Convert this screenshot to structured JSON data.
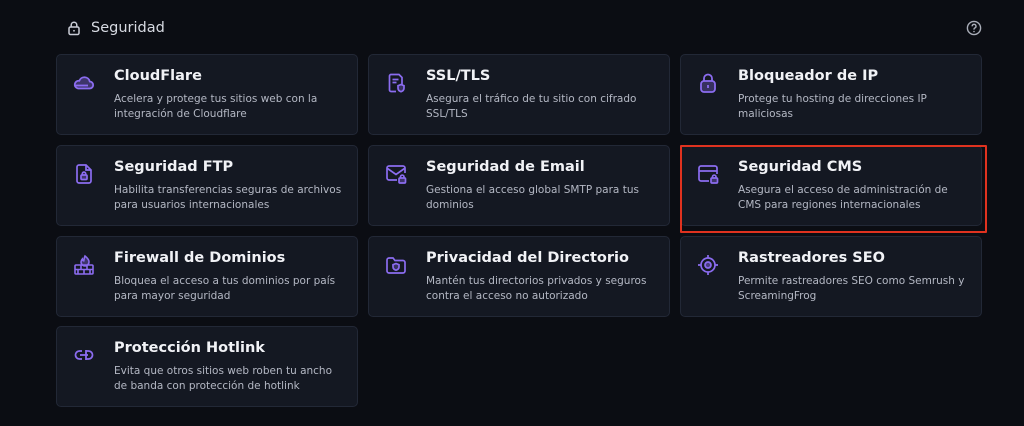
{
  "section": {
    "title": "Seguridad",
    "icon": "lock-icon",
    "help_icon": "help-circle-icon"
  },
  "cards": [
    {
      "title": "CloudFlare",
      "desc": "Acelera y protege tus sitios web con la integración de Cloudflare",
      "icon": "cloud-icon"
    },
    {
      "title": "SSL/TLS",
      "desc": "Asegura el tráfico de tu sitio con cifrado SSL/TLS",
      "icon": "certificate-icon"
    },
    {
      "title": "Bloqueador de IP",
      "desc": "Protege tu hosting de direcciones IP maliciosas",
      "icon": "padlock-icon"
    },
    {
      "title": "Seguridad FTP",
      "desc": "Habilita transferencias seguras de archivos para usuarios internacionales",
      "icon": "file-lock-icon"
    },
    {
      "title": "Seguridad de Email",
      "desc": "Gestiona el acceso global SMTP para tus dominios",
      "icon": "mail-lock-icon"
    },
    {
      "title": "Seguridad CMS",
      "desc": "Asegura el acceso de administración de CMS para regiones internacionales",
      "icon": "browser-lock-icon"
    },
    {
      "title": "Firewall de Dominios",
      "desc": "Bloquea el acceso a tus dominios por país para mayor seguridad",
      "icon": "firewall-icon"
    },
    {
      "title": "Privacidad del Directorio",
      "desc": "Mantén tus directorios privados y seguros contra el acceso no autorizado",
      "icon": "folder-shield-icon"
    },
    {
      "title": "Rastreadores SEO",
      "desc": "Permite rastreadores SEO como Semrush y ScreamingFrog",
      "icon": "crosshair-icon"
    },
    {
      "title": "Protección Hotlink",
      "desc": "Evita que otros sitios web roben tu ancho de banda con protección de hotlink",
      "icon": "link-icon"
    }
  ],
  "colors": {
    "accent": "#8b6cf0",
    "background": "#0b0d13",
    "card": "#141822",
    "highlight": "#e0321f"
  }
}
